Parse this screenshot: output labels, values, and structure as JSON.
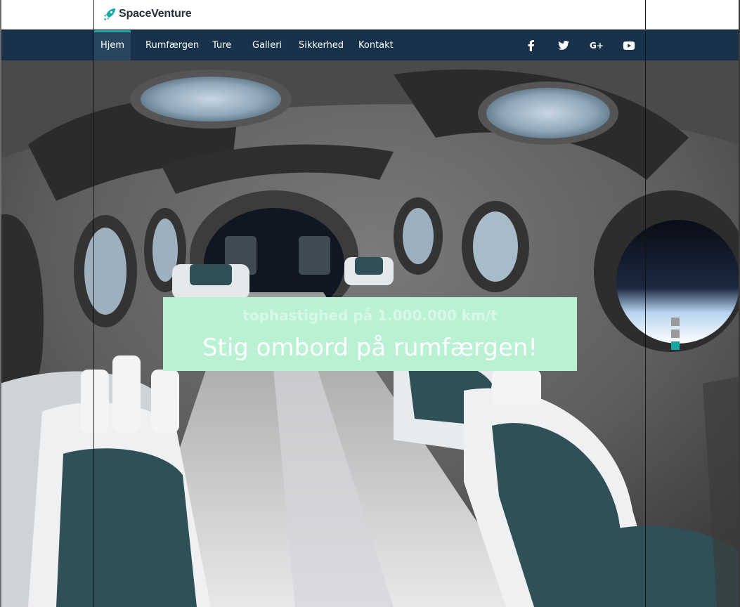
{
  "brand": {
    "name": "SpaceVenture",
    "accent_color": "#17a8a5",
    "nav_color": "#17324a"
  },
  "nav": {
    "items": [
      {
        "label": "Hjem",
        "active": true
      },
      {
        "label": "Rumfærgen",
        "active": false
      },
      {
        "label": "Ture",
        "active": false
      },
      {
        "label": "Galleri",
        "active": false
      },
      {
        "label": "Sikkerhed",
        "active": false
      },
      {
        "label": "Kontakt",
        "active": false
      }
    ],
    "social_icons": [
      "facebook-icon",
      "twitter-icon",
      "google-plus-icon",
      "youtube-icon"
    ],
    "google_plus_label": "G+"
  },
  "hero": {
    "subtitle": "tophastighed på 1.000.000 km/t",
    "title": "Stig ombord på rumfærgen!",
    "slides_total": 3,
    "active_slide": 3,
    "caption_color": "#b8f2d3"
  }
}
